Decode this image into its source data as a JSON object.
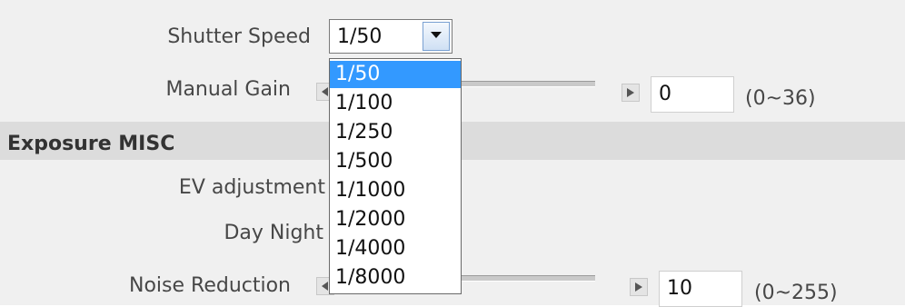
{
  "shutter_speed": {
    "label": "Shutter Speed",
    "selected": "1/50",
    "options": [
      "1/50",
      "1/100",
      "1/250",
      "1/500",
      "1/1000",
      "1/2000",
      "1/4000",
      "1/8000"
    ]
  },
  "manual_gain": {
    "label": "Manual Gain",
    "value": "0",
    "range": "(0~36)"
  },
  "section": {
    "title": "Exposure MISC"
  },
  "ev_adjustment": {
    "label": "EV adjustment"
  },
  "day_night": {
    "label": "Day Night"
  },
  "noise_reduction": {
    "label": "Noise Reduction",
    "value": "10",
    "range": "(0~255)"
  },
  "colors": {
    "selection": "#3399ff",
    "section_bg": "#dcdcdc",
    "row_bg": "#f0f0f0"
  }
}
